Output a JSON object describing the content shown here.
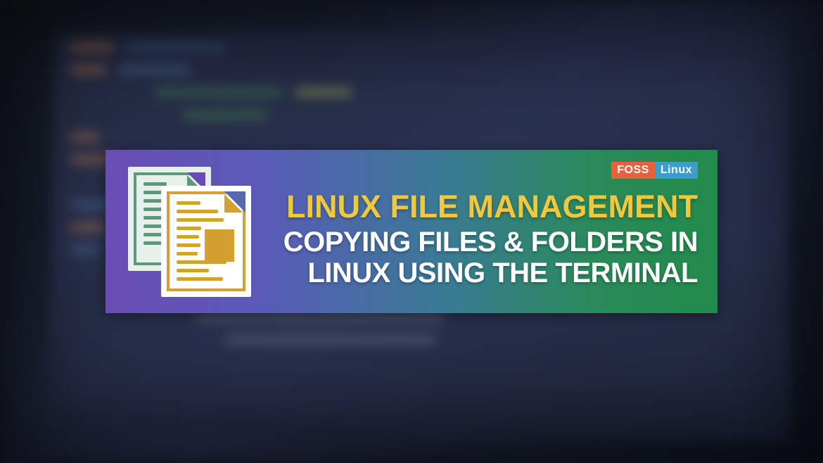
{
  "logo": {
    "part1": "FOSS",
    "part2": "Linux"
  },
  "headline": "LINUX FILE MANAGEMENT",
  "subheadline_line1": "COPYING FILES & FOLDERS IN",
  "subheadline_line2": "LINUX USING THE TERMINAL"
}
